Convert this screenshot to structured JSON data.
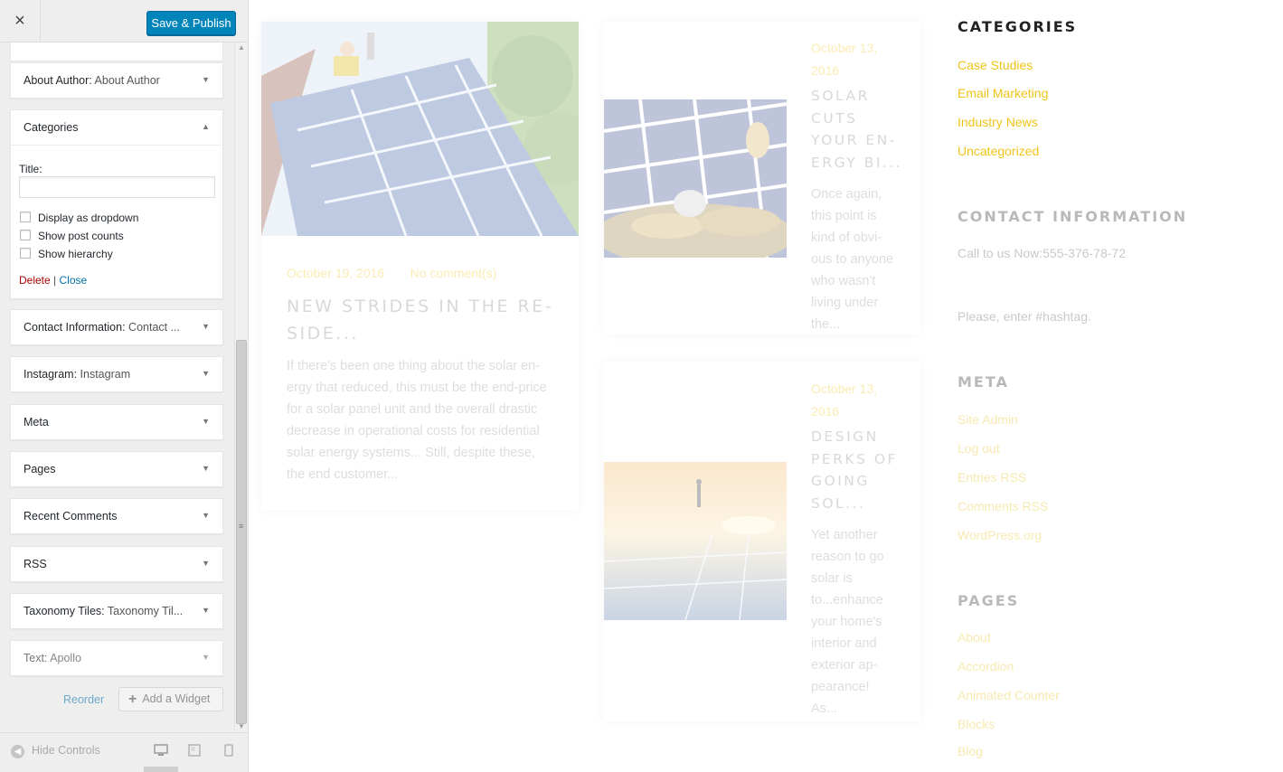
{
  "customizer": {
    "close_label": "×",
    "publish_label": "Save & Publish",
    "widgets": [
      {
        "title": "About Author:",
        "subtitle": " About Author"
      },
      {
        "title": "Categories",
        "subtitle": ""
      },
      {
        "title": "Contact Information:",
        "subtitle": " Contact ..."
      },
      {
        "title": "Instagram:",
        "subtitle": " Instagram"
      },
      {
        "title": "Meta",
        "subtitle": ""
      },
      {
        "title": "Pages",
        "subtitle": ""
      },
      {
        "title": "Recent Comments",
        "subtitle": ""
      },
      {
        "title": "RSS",
        "subtitle": ""
      },
      {
        "title": "Taxonomy Tiles:",
        "subtitle": " Taxonomy Til..."
      },
      {
        "title": "Text:",
        "subtitle": " Apollo"
      }
    ],
    "categories_form": {
      "title_label": "Title:",
      "title_value": "",
      "options": [
        "Display as dropdown",
        "Show post counts",
        "Show hierarchy"
      ],
      "delete_label": "Delete",
      "separator": " | ",
      "close_label": "Close"
    },
    "reorder_label": "Reorder",
    "add_widget_label": "Add a Widget",
    "add_widget_icon": "+",
    "hide_controls_label": "Hide Controls",
    "icons": [
      "close-icon",
      "arrow-down-icon",
      "arrow-up-icon",
      "desktop-icon",
      "tablet-icon",
      "mobile-icon",
      "collapse-icon"
    ]
  },
  "preview": {
    "posts": [
      {
        "date": "October 19, 2016",
        "comments": "No comment(s)",
        "title_lines": [
          "NEW STRIDES IN THE RE-",
          "SIDE..."
        ],
        "excerpt_lines": [
          "If there's been one thing about the solar en-",
          "ergy that reduced, this must be the end-price",
          "for a solar panel unit and the overall drastic",
          "decrease in operational costs for residential",
          "solar energy systems... Still, despite these,",
          "the end customer..."
        ]
      },
      {
        "date_lines": [
          "October 13,",
          "2016"
        ],
        "title_lines": [
          "SOLAR",
          "CUTS",
          "YOUR EN-",
          "ERGY BI..."
        ],
        "excerpt_lines": [
          "Once again,",
          "this point is",
          "kind of obvi-",
          "ous to anyone",
          "who wasn't",
          "living under",
          "the..."
        ]
      },
      {
        "date_lines": [
          "October 13,",
          "2016"
        ],
        "title_lines": [
          "DESIGN",
          "PERKS OF",
          "GOING",
          "SOL..."
        ],
        "excerpt_lines": [
          "Yet another",
          "reason to go",
          "solar is",
          "to...enhance",
          "your home's",
          "interior and",
          "exterior ap-",
          "pearance!",
          "As..."
        ]
      }
    ],
    "sidebar": {
      "categories_heading": "CATEGORIES",
      "categories": [
        "Case Studies",
        "Email Marketing",
        "Industry News",
        "Uncategorized"
      ],
      "contact_heading": "CONTACT INFORMATION",
      "contact_call": "Call to us Now:555-376-78-72",
      "hashtag_text": "Please, enter #hashtag.",
      "meta_heading": "META",
      "meta_links": [
        "Site Admin",
        "Log out",
        "Entries RSS",
        "Comments RSS",
        "WordPress.org"
      ],
      "pages_heading": "PAGES",
      "pages_links": [
        "About",
        "Accordion",
        "Animated Counter",
        "Blocks",
        "Blog"
      ]
    }
  },
  "colors": {
    "accent_blue": "#0085ba",
    "link_yellow": "#f0c419",
    "delete_red": "#aa0000"
  }
}
